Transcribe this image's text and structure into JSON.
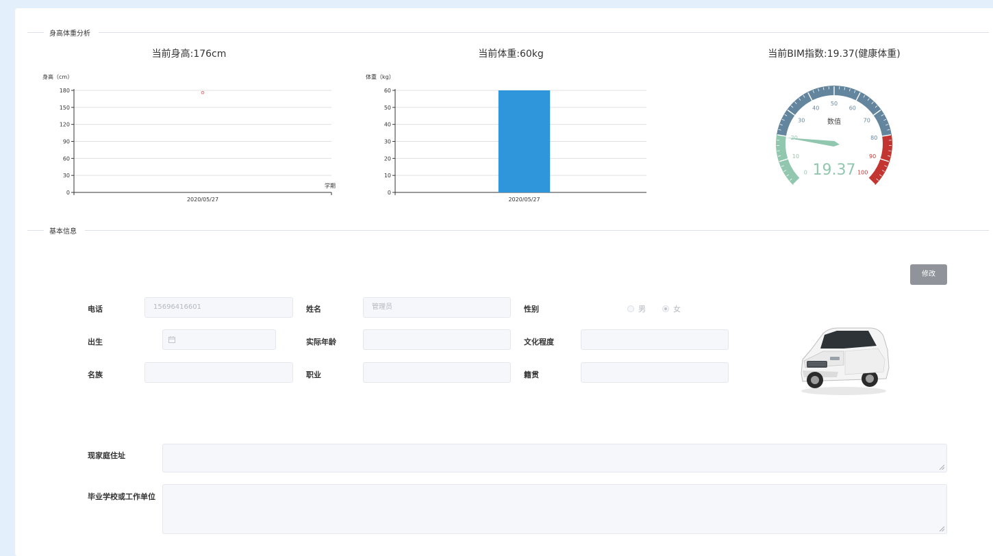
{
  "sections": {
    "analysis_title": "身高体重分析",
    "basic_title": "基本信息"
  },
  "height_chart": {
    "title": "当前身高:176cm",
    "ylabel": "身高（cm）",
    "xlabel": "学期"
  },
  "weight_chart": {
    "title": "当前体重:60kg",
    "ylabel": "体重（kg）"
  },
  "bmi_gauge": {
    "title": "当前BIM指数:19.37(健康体重)",
    "center_label": "数值",
    "value_text": "19.37"
  },
  "chart_data": [
    {
      "type": "scatter",
      "title": "当前身高:176cm",
      "ylabel": "身高（cm）",
      "xlabel": "学期",
      "categories": [
        "2020/05/27"
      ],
      "values": [
        176
      ],
      "ylim": [
        0,
        180
      ],
      "yticks": [
        "0",
        "30",
        "60",
        "90",
        "120",
        "150",
        "180"
      ],
      "grid": true,
      "color": "#e57373"
    },
    {
      "type": "bar",
      "title": "当前体重:60kg",
      "ylabel": "体重（kg）",
      "categories": [
        "2020/05/27"
      ],
      "values": [
        60
      ],
      "ylim": [
        0,
        60
      ],
      "yticks": [
        "0",
        "10",
        "20",
        "30",
        "40",
        "50",
        "60"
      ],
      "grid": true,
      "color": "#3096db"
    },
    {
      "type": "gauge",
      "title": "当前BIM指数:19.37(健康体重)",
      "value": 19.37,
      "range": [
        0,
        100
      ],
      "tick_labels": [
        "0",
        "10",
        "20",
        "30",
        "40",
        "50",
        "60",
        "70",
        "80",
        "90",
        "100"
      ],
      "bands": [
        {
          "to": 20,
          "color": "#91c7ae"
        },
        {
          "to": 80,
          "color": "#63869e"
        },
        {
          "to": 100,
          "color": "#c23531"
        }
      ]
    }
  ],
  "form": {
    "edit_button": "修改",
    "phone_label": "电话",
    "phone_value": "15696416601",
    "name_label": "姓名",
    "name_value": "管理员",
    "gender_label": "性别",
    "gender_male": "男",
    "gender_female": "女",
    "gender_selected": "女",
    "birth_label": "出生",
    "age_label": "实际年龄",
    "education_label": "文化程度",
    "ethnicity_label": "名族",
    "job_label": "职业",
    "native_label": "籍贯",
    "address_label": "现家庭住址",
    "school_label": "毕业学校或工作单位"
  },
  "icons": {
    "calendar": "calendar-icon",
    "avatar": "car-photo"
  }
}
